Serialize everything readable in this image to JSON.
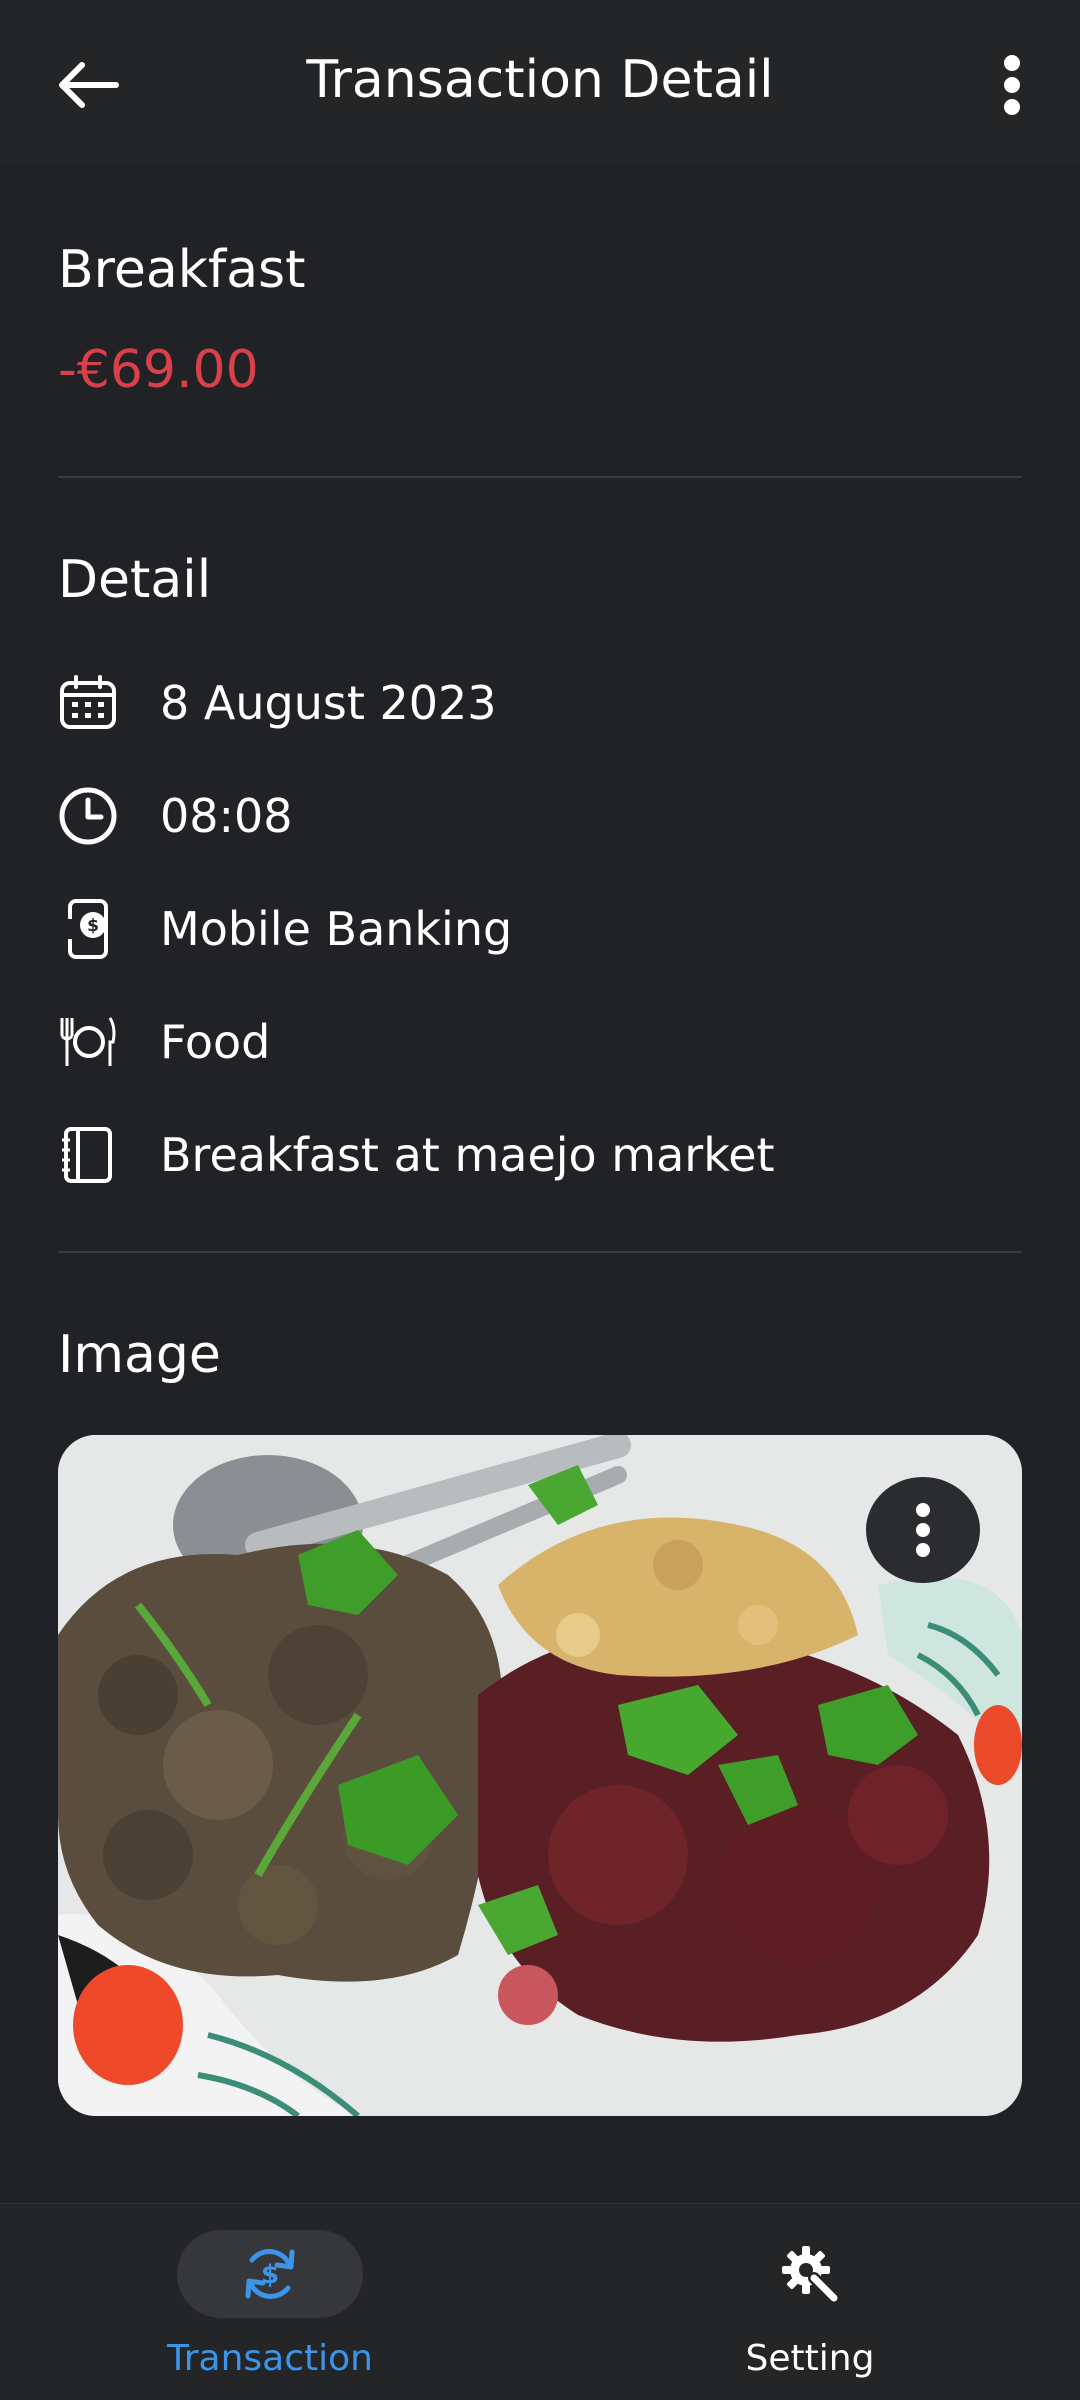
{
  "header": {
    "title": "Transaction Detail"
  },
  "transaction": {
    "name": "Breakfast",
    "amount": "-€69.00"
  },
  "detail": {
    "section_title": "Detail",
    "date": "8 August 2023",
    "time": "08:08",
    "payment_method": "Mobile Banking",
    "category": "Food",
    "note": "Breakfast at maejo market"
  },
  "image_section": {
    "section_title": "Image"
  },
  "bottom_nav": {
    "items": [
      {
        "label": "Transaction",
        "active": true
      },
      {
        "label": "Setting",
        "active": false
      }
    ]
  },
  "colors": {
    "background": "#212225",
    "bar": "#242527",
    "expense": "#d8414a",
    "accent": "#3c95e8"
  },
  "icons": {
    "back": "arrow-left-icon",
    "more": "more-vertical-icon",
    "date": "calendar-icon",
    "time": "clock-icon",
    "payment": "mobile-payment-icon",
    "category": "plate-cutlery-icon",
    "note": "notebook-icon",
    "nav_transaction": "dollar-refresh-icon",
    "nav_setting": "gear-wrench-icon"
  }
}
